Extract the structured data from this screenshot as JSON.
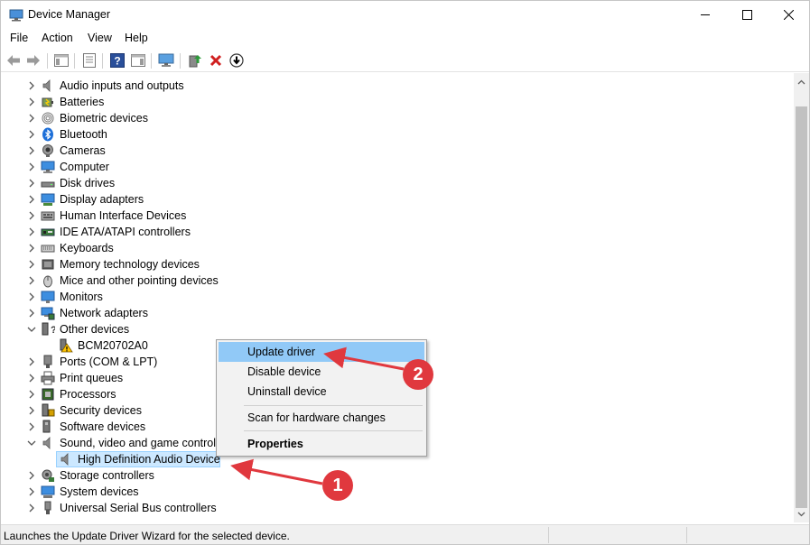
{
  "window": {
    "title": "Device Manager"
  },
  "menu": [
    "File",
    "Action",
    "View",
    "Help"
  ],
  "tree": {
    "items": [
      {
        "label": "Audio inputs and outputs",
        "icon": "speaker-icon",
        "expanded": false
      },
      {
        "label": "Batteries",
        "icon": "battery-icon",
        "expanded": false
      },
      {
        "label": "Biometric devices",
        "icon": "fingerprint-icon",
        "expanded": false
      },
      {
        "label": "Bluetooth",
        "icon": "bluetooth-icon",
        "expanded": false
      },
      {
        "label": "Cameras",
        "icon": "camera-icon",
        "expanded": false
      },
      {
        "label": "Computer",
        "icon": "monitor-icon",
        "expanded": false
      },
      {
        "label": "Disk drives",
        "icon": "disk-icon",
        "expanded": false
      },
      {
        "label": "Display adapters",
        "icon": "display-adapter-icon",
        "expanded": false
      },
      {
        "label": "Human Interface Devices",
        "icon": "hid-icon",
        "expanded": false
      },
      {
        "label": "IDE ATA/ATAPI controllers",
        "icon": "ide-icon",
        "expanded": false
      },
      {
        "label": "Keyboards",
        "icon": "keyboard-icon",
        "expanded": false
      },
      {
        "label": "Memory technology devices",
        "icon": "memory-icon",
        "expanded": false
      },
      {
        "label": "Mice and other pointing devices",
        "icon": "mouse-icon",
        "expanded": false
      },
      {
        "label": "Monitors",
        "icon": "monitor-icon",
        "expanded": false
      },
      {
        "label": "Network adapters",
        "icon": "network-icon",
        "expanded": false
      },
      {
        "label": "Other devices",
        "icon": "other-devices-icon",
        "expanded": true
      },
      {
        "label": "BCM20702A0",
        "icon": "warning-device-icon",
        "child": true
      },
      {
        "label": "Ports (COM & LPT)",
        "icon": "port-icon",
        "expanded": false
      },
      {
        "label": "Print queues",
        "icon": "printer-icon",
        "expanded": false
      },
      {
        "label": "Processors",
        "icon": "processor-icon",
        "expanded": false
      },
      {
        "label": "Security devices",
        "icon": "security-icon",
        "expanded": false
      },
      {
        "label": "Software devices",
        "icon": "software-icon",
        "expanded": false
      },
      {
        "label": "Sound, video and game controlle",
        "icon": "speaker-icon",
        "expanded": true
      },
      {
        "label": "High Definition Audio Device",
        "icon": "speaker-icon",
        "child": true,
        "selected": true
      },
      {
        "label": "Storage controllers",
        "icon": "storage-icon",
        "expanded": false
      },
      {
        "label": "System devices",
        "icon": "system-icon",
        "expanded": false
      },
      {
        "label": "Universal Serial Bus controllers",
        "icon": "usb-icon",
        "expanded": false
      }
    ]
  },
  "context_menu": {
    "update": "Update driver",
    "disable": "Disable device",
    "uninstall": "Uninstall device",
    "scan": "Scan for hardware changes",
    "properties": "Properties"
  },
  "annotations": {
    "badge1": "1",
    "badge2": "2"
  },
  "status": {
    "text": "Launches the Update Driver Wizard for the selected device."
  },
  "colors": {
    "selection": "#cce8ff",
    "menu_highlight": "#91c9f7",
    "annotation": "#e0383e"
  }
}
